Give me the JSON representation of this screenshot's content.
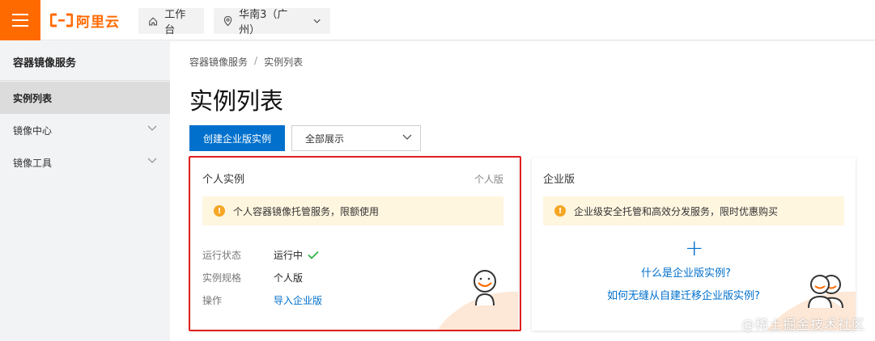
{
  "topbar": {
    "menu_icon": "hamburger-icon",
    "logo_text": "阿里云",
    "workbench_label": "工作台",
    "region_label": "华南3（广州）"
  },
  "sidebar": {
    "title": "容器镜像服务",
    "items": [
      {
        "label": "实例列表",
        "active": true,
        "expandable": false
      },
      {
        "label": "镜像中心",
        "active": false,
        "expandable": true
      },
      {
        "label": "镜像工具",
        "active": false,
        "expandable": true
      }
    ]
  },
  "breadcrumb": {
    "items": [
      "容器镜像服务",
      "实例列表"
    ],
    "separator": "/"
  },
  "page": {
    "title": "实例列表",
    "create_button": "创建企业版实例",
    "filter_select": "全部展示"
  },
  "personal_card": {
    "title": "个人实例",
    "tag": "个人版",
    "notice": "个人容器镜像托管服务，限额使用",
    "fields": [
      {
        "label": "运行状态",
        "value": "运行中"
      },
      {
        "label": "实例规格",
        "value": "个人版"
      },
      {
        "label": "操作",
        "value": "导入企业版"
      }
    ]
  },
  "enterprise_card": {
    "title": "企业版",
    "notice": "企业级安全托管和高效分发服务，限时优惠购买",
    "plus": "+",
    "link1": "什么是企业版实例?",
    "link2": "如何无缝从自建迁移企业版实例?"
  },
  "watermark": "@稀土掘金技术社区",
  "colors": {
    "brand_orange": "#ff6a00",
    "primary_blue": "#0070cc",
    "highlight_red": "#e02020",
    "notice_bg": "#fff6e0",
    "success_green": "#2fb344"
  }
}
